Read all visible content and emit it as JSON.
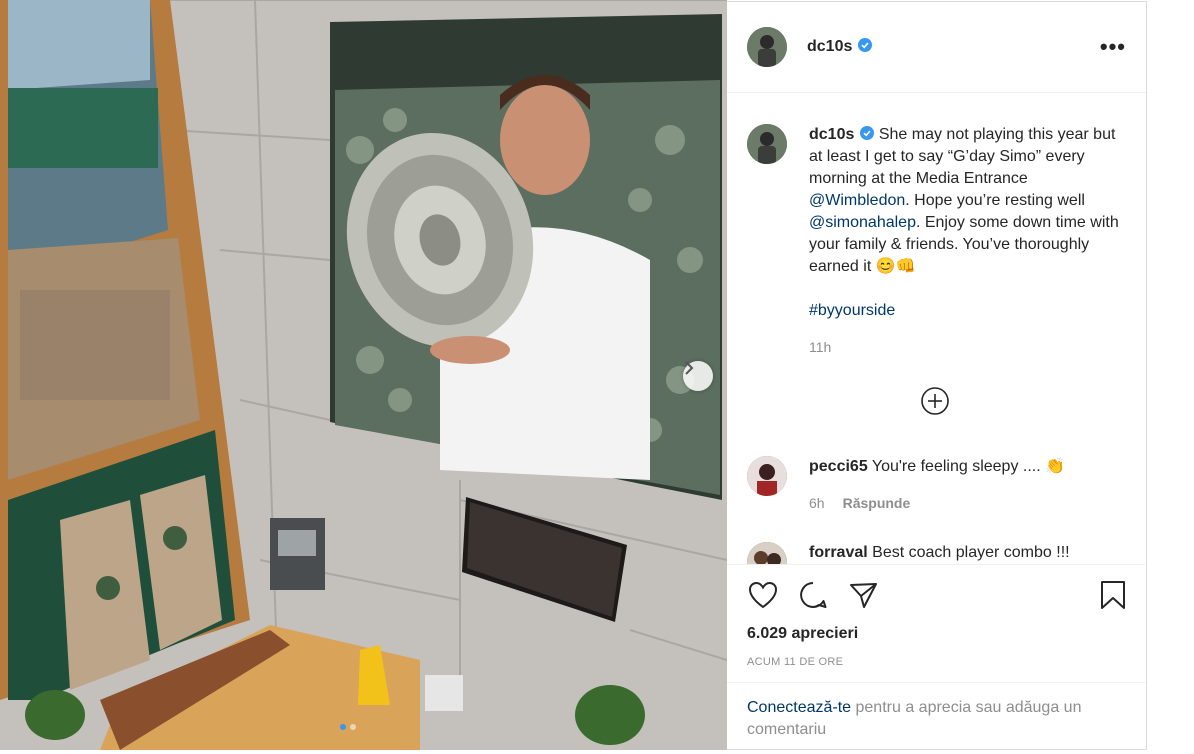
{
  "post": {
    "author": "dc10s",
    "image_alt": "Photo of Simona Halep holding the Wimbledon trophy at the Media Entrance",
    "carousel": {
      "total": 2,
      "active": 1
    }
  },
  "header": {
    "username": "dc10s",
    "more_label": "•••"
  },
  "caption": {
    "username": "dc10s",
    "text_1": "She may not playing this year but at least I get to say “G’day Simo” every morning at the Media Entrance ",
    "mention_1": "@Wimbledon",
    "text_2": ". Hope you’re resting well ",
    "mention_2": "@simonahalep",
    "text_3": ". Enjoy some down time with your family & friends. You’ve thoroughly earned it 😊👊",
    "hashtag": "#byyourside",
    "time": "11h"
  },
  "comments": [
    {
      "username": "pecci65",
      "text": "You're feeling sleepy .... 👏",
      "time": "6h",
      "reply_label": "Răspunde"
    },
    {
      "username": "forraval",
      "text": "Best coach player combo !!!"
    }
  ],
  "actions": {
    "likes": "6.029 aprecieri",
    "posted": "ACUM 11 DE ORE"
  },
  "login": {
    "link": "Conectează-te",
    "text": " pentru a aprecia sau adăuga un comentariu"
  },
  "colors": {
    "link": "#00376b",
    "verified": "#3897f0",
    "meta": "#8e8e8e",
    "border": "#dbdbdb"
  }
}
